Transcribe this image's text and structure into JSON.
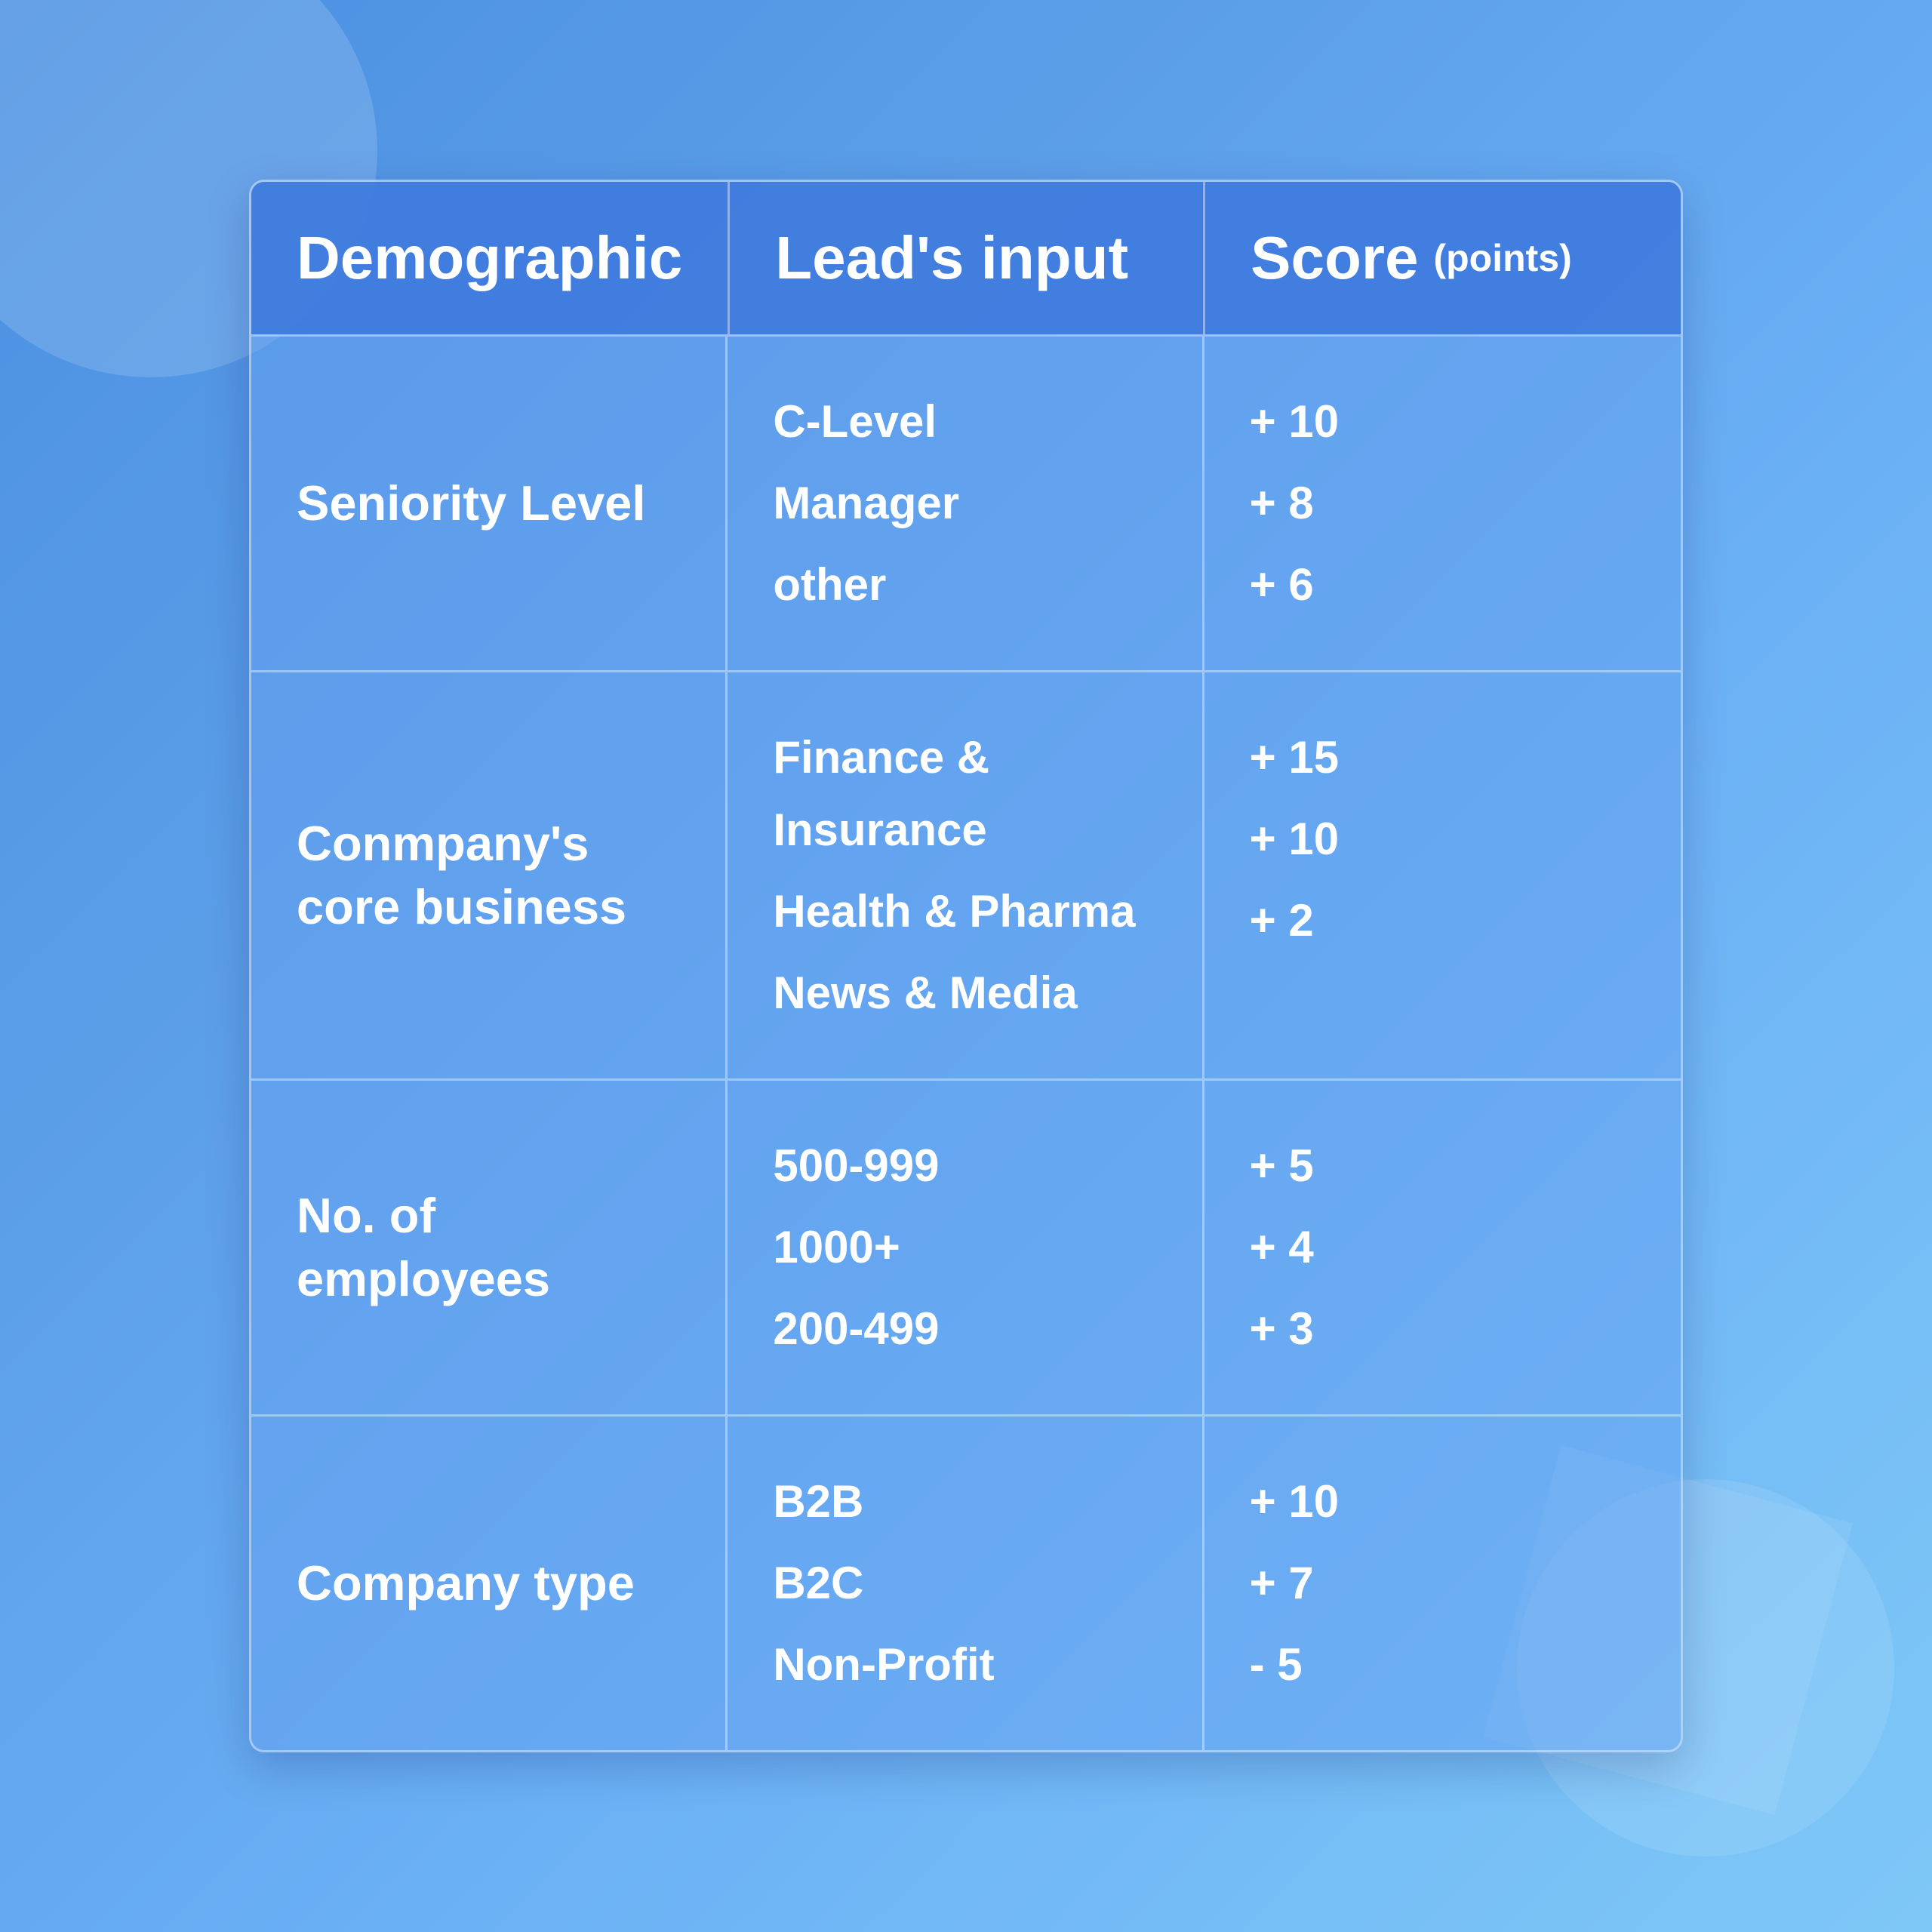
{
  "background": {
    "gradient_start": "#4a90e2",
    "gradient_end": "#7ec8f7"
  },
  "table": {
    "header": {
      "col1": "Demographic",
      "col2": "Lead's input",
      "col3_main": "Score",
      "col3_sub": "(points)"
    },
    "rows": [
      {
        "demographic": "Seniority Level",
        "inputs": [
          "C-Level",
          "Manager",
          "other"
        ],
        "scores": [
          "+ 10",
          "+ 8",
          "+ 6"
        ]
      },
      {
        "demographic": "Conmpany's core business",
        "inputs": [
          "Finance & Insurance",
          "Health & Pharma",
          "News & Media"
        ],
        "scores": [
          "+ 15",
          "+ 10",
          "+ 2"
        ]
      },
      {
        "demographic": "No. of employees",
        "inputs": [
          "500-999",
          "1000+",
          "200-499"
        ],
        "scores": [
          "+ 5",
          "+ 4",
          "+ 3"
        ]
      },
      {
        "demographic": "Company type",
        "inputs": [
          "B2B",
          "B2C",
          "Non-Profit"
        ],
        "scores": [
          "+ 10",
          "+ 7",
          "- 5"
        ]
      }
    ]
  }
}
